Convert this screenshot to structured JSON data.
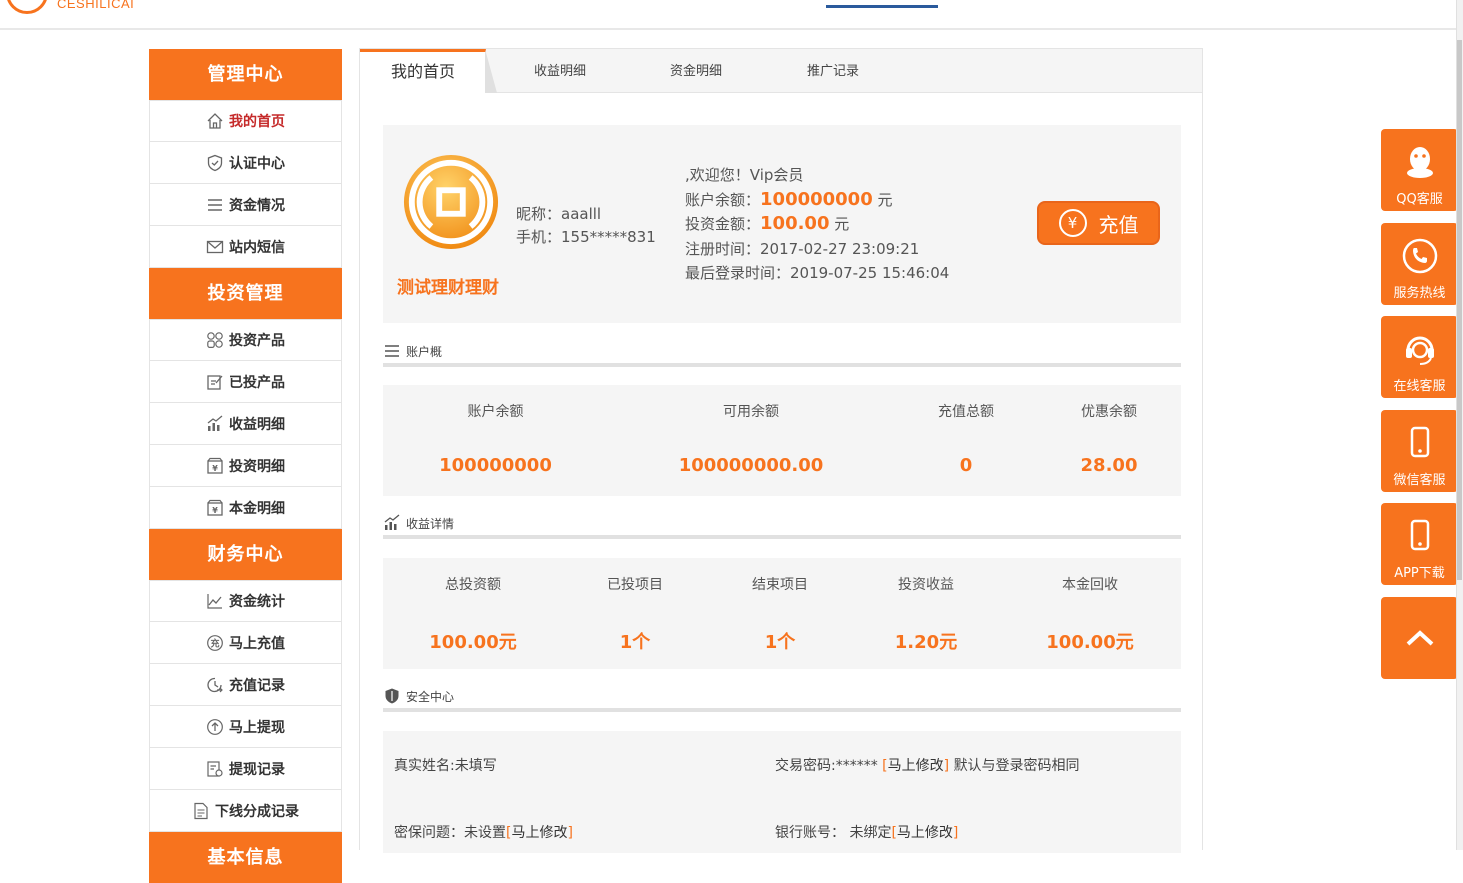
{
  "header": {
    "logo_text": "CESHILICAI"
  },
  "sidebar": {
    "groups": [
      {
        "title": "管理中心",
        "items": [
          "我的首页",
          "认证中心",
          "资金情况",
          "站内短信"
        ]
      },
      {
        "title": "投资管理",
        "items": [
          "投资产品",
          "已投产品",
          "收益明细",
          "投资明细",
          "本金明细"
        ]
      },
      {
        "title": "财务中心",
        "items": [
          "资金统计",
          "马上充值",
          "充值记录",
          "马上提现",
          "提现记录",
          "下线分成记录"
        ]
      },
      {
        "title": "基本信息"
      }
    ]
  },
  "tabs": [
    "我的首页",
    "收益明细",
    "资金明细",
    "推广记录"
  ],
  "profile": {
    "site_name": "测试理财理财",
    "nickname": "昵称：aaalll",
    "phone": "手机：155*****831",
    "welcome": ",欢迎您！Vip会员",
    "balance_label": "账户余额：",
    "balance_value": "100000000",
    "balance_unit": "元",
    "invest_label": "投资金额：",
    "invest_value": "100.00",
    "invest_unit": "元",
    "register_time": "注册时间：2017-02-27 23:09:21",
    "last_login": "最后登录时间：2019-07-25 15:46:04",
    "recharge_label": "充值",
    "recharge_icon": "¥"
  },
  "account": {
    "title": "账户概",
    "stats": [
      {
        "label": "账户余额",
        "value": "100000000"
      },
      {
        "label": "可用余额",
        "value": "100000000.00"
      },
      {
        "label": "充值总额",
        "value": "0"
      },
      {
        "label": "优惠余额",
        "value": "28.00"
      }
    ]
  },
  "income": {
    "title": "收益详情",
    "stats": [
      {
        "label": "总投资额",
        "value": "100.00元"
      },
      {
        "label": "已投项目",
        "value": "1个"
      },
      {
        "label": "结束项目",
        "value": "1个"
      },
      {
        "label": "投资收益",
        "value": "1.20元"
      },
      {
        "label": "本金回收",
        "value": "100.00元"
      }
    ]
  },
  "security": {
    "title": "安全中心",
    "real_name": "真实姓名:未填写",
    "trade_pwd": "交易密码:******",
    "trade_pwd_note": "默认与登录密码相同",
    "question": "密保问题：未设置",
    "bank": "银行账号： 未绑定",
    "modify_link": "马上修改"
  },
  "float_menu": [
    "QQ客服",
    "服务热线",
    "在线客服",
    "微信客服",
    "APP下载"
  ],
  "colors": {
    "accent": "#f7731e",
    "panel": "#f5f5f5"
  }
}
